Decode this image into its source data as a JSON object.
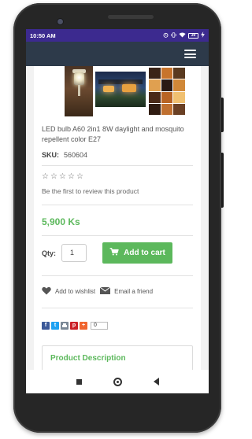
{
  "status_bar": {
    "time": "10:50 AM",
    "icons": [
      "clock-alarm-icon",
      "no-disturb-icon",
      "vibrate-icon",
      "wifi-icon",
      "battery-icon",
      "charging-icon"
    ],
    "battery_label": "39"
  },
  "app_bar": {
    "menu_icon": "hamburger-menu-icon"
  },
  "product": {
    "images": [
      "garden-lamp-photo",
      "house-night-photo",
      "lighting-collage-photo"
    ],
    "title": "LED bulb A60 2in1 8W daylight and mosquito repellent color E27",
    "sku_label": "SKU:",
    "sku_value": "560604",
    "rating_stars": 5,
    "rating_value": 0,
    "review_prompt": "Be the first to review this product",
    "price": "5,900 Ks",
    "qty_label": "Qty:",
    "qty_value": "1",
    "add_to_cart_label": "Add to cart",
    "wishlist_label": "Add to wishlist",
    "email_label": "Email a friend",
    "share": {
      "networks": [
        "f",
        "t",
        "p",
        "+"
      ],
      "count": "0"
    },
    "description_title": "Product Description"
  },
  "colors": {
    "status_bar": "#3c2a8f",
    "app_bar": "#2d3a4a",
    "accent_green": "#5cb85c"
  }
}
